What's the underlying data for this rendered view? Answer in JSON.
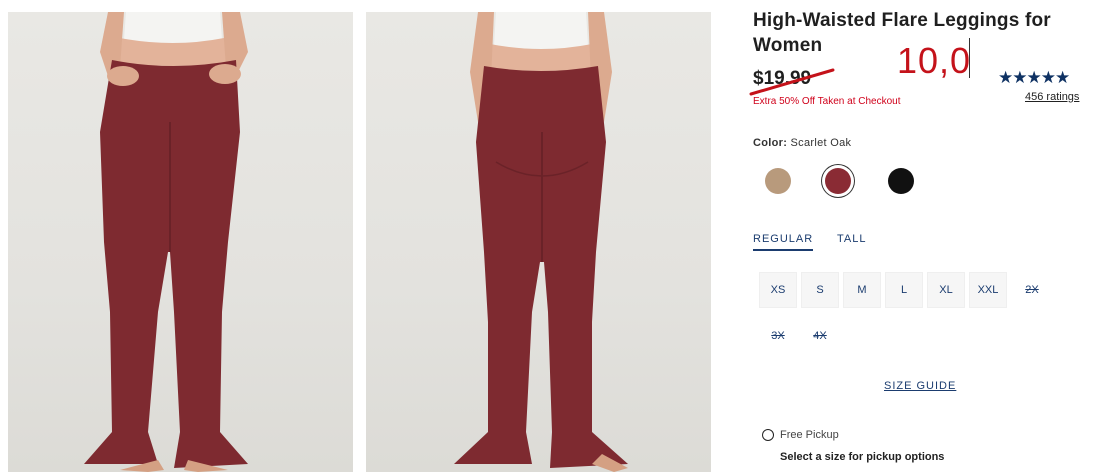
{
  "product": {
    "title": "High-Waisted Flare Leggings for Women",
    "old_price": "$19.99",
    "promo": "Extra 50% Off Taken at Checkout",
    "typed_price": "10,0",
    "rating_value": 4.5,
    "rating_stars": "★★★★",
    "rating_half": "★",
    "rating_empty": "★",
    "ratings_count": "456 ratings"
  },
  "color": {
    "label": "Color:",
    "value": "Scarlet Oak",
    "swatches": [
      {
        "name": "tan",
        "hex": "#b89a7c"
      },
      {
        "name": "scarlet-oak",
        "hex": "#8a2b34"
      },
      {
        "name": "black",
        "hex": "#111111"
      }
    ]
  },
  "fit_tabs": [
    "REGULAR",
    "TALL"
  ],
  "sizes": [
    {
      "label": "XS",
      "available": true
    },
    {
      "label": "S",
      "available": true
    },
    {
      "label": "M",
      "available": true
    },
    {
      "label": "L",
      "available": true
    },
    {
      "label": "XL",
      "available": true
    },
    {
      "label": "XXL",
      "available": true
    },
    {
      "label": "2X",
      "available": false
    },
    {
      "label": "3X",
      "available": false
    },
    {
      "label": "4X",
      "available": false
    }
  ],
  "size_guide": "SIZE GUIDE",
  "pickup": {
    "option": "Free Pickup",
    "note": "Select a size for pickup options"
  },
  "colors": {
    "brand_navy": "#1b3c6f",
    "sale_red": "#d0021b",
    "leggings": "#7e2a30"
  }
}
